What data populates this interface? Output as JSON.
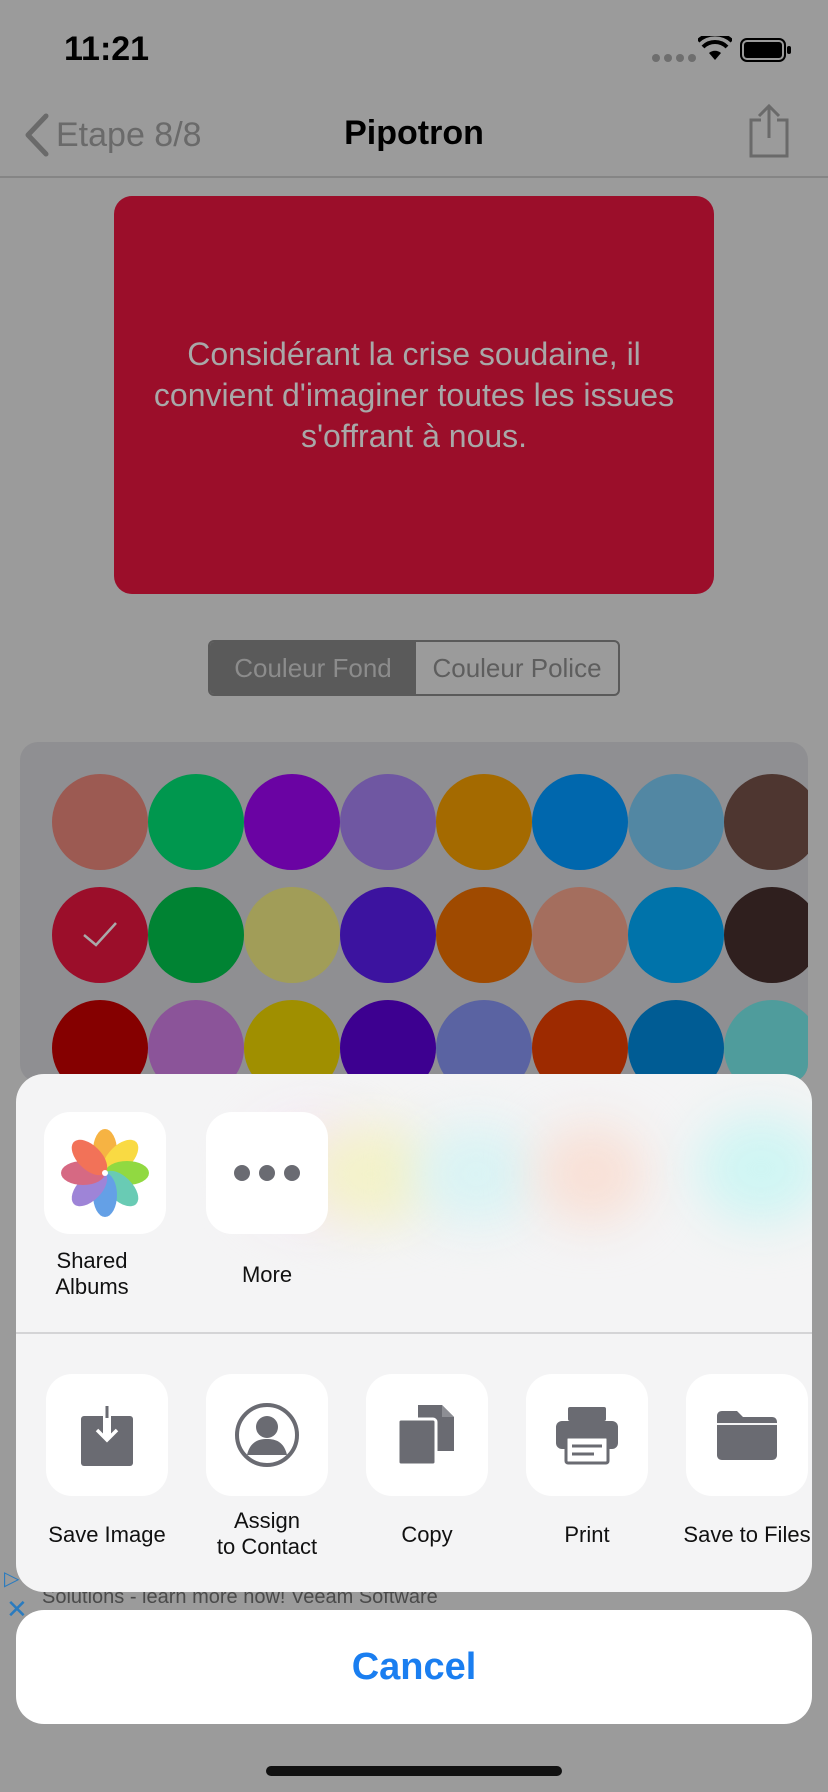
{
  "status_bar": {
    "time": "11:21"
  },
  "nav": {
    "back_label": "Etape 8/8",
    "title": "Pipotron"
  },
  "preview": {
    "text": "Considérant la crise soudaine, il convient d'imaginer toutes les issues s'offrant à nous.",
    "background_color": "#9b0e2a",
    "text_color": "#a8a8a8"
  },
  "segmented": {
    "options": [
      "Couleur Fond",
      "Couleur Police"
    ],
    "selected": "Couleur Fond"
  },
  "palette": {
    "rows": [
      [
        "#9c5a52",
        "#00974e",
        "#6a03a3",
        "#6f57a2",
        "#a46a00",
        "#0067ad",
        "#5287a3",
        "#4e3630"
      ],
      [
        "#9b0e2a",
        "#008333",
        "#a19d58",
        "#3c139f",
        "#9f4a00",
        "#a46e5e",
        "#0073aa",
        "#2f1f1e"
      ],
      [
        "#850000",
        "#8b5499",
        "#a08f00",
        "#3d0090",
        "#5a63a2",
        "#9d2a00",
        "#005c94",
        "#4f9c9c"
      ]
    ],
    "selected": "#9b0e2a"
  },
  "ad": {
    "text": "Solutions - learn more now! Veeam Software"
  },
  "share_sheet": {
    "apps": [
      {
        "label": "Shared\nAlbums",
        "icon": "photos-icon"
      },
      {
        "label": "More",
        "icon": "more-icon"
      }
    ],
    "actions": [
      {
        "label": "Save Image",
        "icon": "save-image-icon"
      },
      {
        "label": "Assign\nto Contact",
        "icon": "contact-icon"
      },
      {
        "label": "Copy",
        "icon": "copy-icon"
      },
      {
        "label": "Print",
        "icon": "print-icon"
      },
      {
        "label": "Save to Files",
        "icon": "folder-icon"
      }
    ],
    "cancel_label": "Cancel"
  },
  "colors": {
    "accent": "#1a7ef0",
    "icon_gray": "#6a6b72"
  }
}
